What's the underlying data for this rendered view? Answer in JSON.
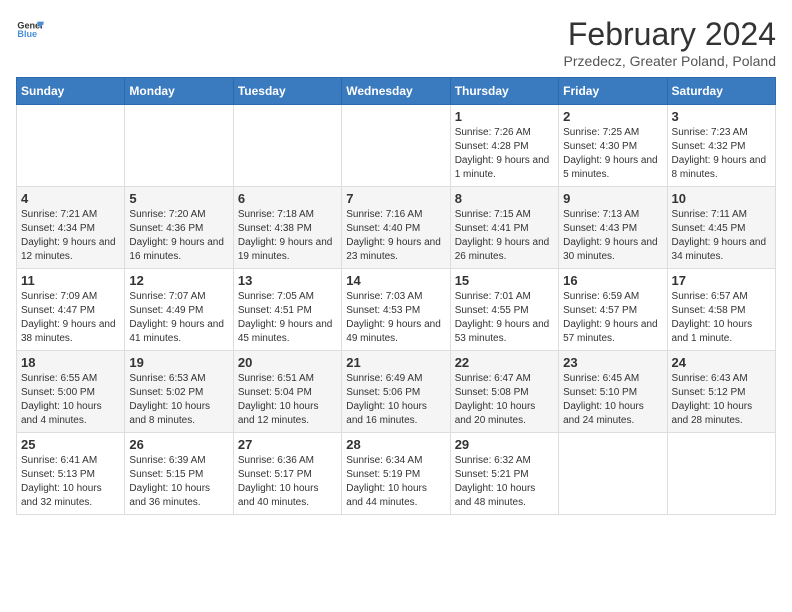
{
  "header": {
    "logo_general": "General",
    "logo_blue": "Blue",
    "title": "February 2024",
    "subtitle": "Przedecz, Greater Poland, Poland"
  },
  "weekdays": [
    "Sunday",
    "Monday",
    "Tuesday",
    "Wednesday",
    "Thursday",
    "Friday",
    "Saturday"
  ],
  "weeks": [
    [
      {
        "day": "",
        "info": ""
      },
      {
        "day": "",
        "info": ""
      },
      {
        "day": "",
        "info": ""
      },
      {
        "day": "",
        "info": ""
      },
      {
        "day": "1",
        "info": "Sunrise: 7:26 AM\nSunset: 4:28 PM\nDaylight: 9 hours and 1 minute."
      },
      {
        "day": "2",
        "info": "Sunrise: 7:25 AM\nSunset: 4:30 PM\nDaylight: 9 hours and 5 minutes."
      },
      {
        "day": "3",
        "info": "Sunrise: 7:23 AM\nSunset: 4:32 PM\nDaylight: 9 hours and 8 minutes."
      }
    ],
    [
      {
        "day": "4",
        "info": "Sunrise: 7:21 AM\nSunset: 4:34 PM\nDaylight: 9 hours and 12 minutes."
      },
      {
        "day": "5",
        "info": "Sunrise: 7:20 AM\nSunset: 4:36 PM\nDaylight: 9 hours and 16 minutes."
      },
      {
        "day": "6",
        "info": "Sunrise: 7:18 AM\nSunset: 4:38 PM\nDaylight: 9 hours and 19 minutes."
      },
      {
        "day": "7",
        "info": "Sunrise: 7:16 AM\nSunset: 4:40 PM\nDaylight: 9 hours and 23 minutes."
      },
      {
        "day": "8",
        "info": "Sunrise: 7:15 AM\nSunset: 4:41 PM\nDaylight: 9 hours and 26 minutes."
      },
      {
        "day": "9",
        "info": "Sunrise: 7:13 AM\nSunset: 4:43 PM\nDaylight: 9 hours and 30 minutes."
      },
      {
        "day": "10",
        "info": "Sunrise: 7:11 AM\nSunset: 4:45 PM\nDaylight: 9 hours and 34 minutes."
      }
    ],
    [
      {
        "day": "11",
        "info": "Sunrise: 7:09 AM\nSunset: 4:47 PM\nDaylight: 9 hours and 38 minutes."
      },
      {
        "day": "12",
        "info": "Sunrise: 7:07 AM\nSunset: 4:49 PM\nDaylight: 9 hours and 41 minutes."
      },
      {
        "day": "13",
        "info": "Sunrise: 7:05 AM\nSunset: 4:51 PM\nDaylight: 9 hours and 45 minutes."
      },
      {
        "day": "14",
        "info": "Sunrise: 7:03 AM\nSunset: 4:53 PM\nDaylight: 9 hours and 49 minutes."
      },
      {
        "day": "15",
        "info": "Sunrise: 7:01 AM\nSunset: 4:55 PM\nDaylight: 9 hours and 53 minutes."
      },
      {
        "day": "16",
        "info": "Sunrise: 6:59 AM\nSunset: 4:57 PM\nDaylight: 9 hours and 57 minutes."
      },
      {
        "day": "17",
        "info": "Sunrise: 6:57 AM\nSunset: 4:58 PM\nDaylight: 10 hours and 1 minute."
      }
    ],
    [
      {
        "day": "18",
        "info": "Sunrise: 6:55 AM\nSunset: 5:00 PM\nDaylight: 10 hours and 4 minutes."
      },
      {
        "day": "19",
        "info": "Sunrise: 6:53 AM\nSunset: 5:02 PM\nDaylight: 10 hours and 8 minutes."
      },
      {
        "day": "20",
        "info": "Sunrise: 6:51 AM\nSunset: 5:04 PM\nDaylight: 10 hours and 12 minutes."
      },
      {
        "day": "21",
        "info": "Sunrise: 6:49 AM\nSunset: 5:06 PM\nDaylight: 10 hours and 16 minutes."
      },
      {
        "day": "22",
        "info": "Sunrise: 6:47 AM\nSunset: 5:08 PM\nDaylight: 10 hours and 20 minutes."
      },
      {
        "day": "23",
        "info": "Sunrise: 6:45 AM\nSunset: 5:10 PM\nDaylight: 10 hours and 24 minutes."
      },
      {
        "day": "24",
        "info": "Sunrise: 6:43 AM\nSunset: 5:12 PM\nDaylight: 10 hours and 28 minutes."
      }
    ],
    [
      {
        "day": "25",
        "info": "Sunrise: 6:41 AM\nSunset: 5:13 PM\nDaylight: 10 hours and 32 minutes."
      },
      {
        "day": "26",
        "info": "Sunrise: 6:39 AM\nSunset: 5:15 PM\nDaylight: 10 hours and 36 minutes."
      },
      {
        "day": "27",
        "info": "Sunrise: 6:36 AM\nSunset: 5:17 PM\nDaylight: 10 hours and 40 minutes."
      },
      {
        "day": "28",
        "info": "Sunrise: 6:34 AM\nSunset: 5:19 PM\nDaylight: 10 hours and 44 minutes."
      },
      {
        "day": "29",
        "info": "Sunrise: 6:32 AM\nSunset: 5:21 PM\nDaylight: 10 hours and 48 minutes."
      },
      {
        "day": "",
        "info": ""
      },
      {
        "day": "",
        "info": ""
      }
    ]
  ]
}
